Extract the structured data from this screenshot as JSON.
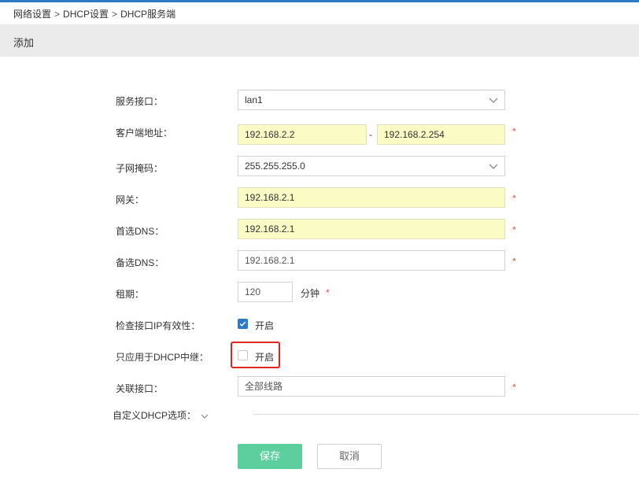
{
  "breadcrumb": {
    "item1": "网络设置",
    "item2": "DHCP设置",
    "item3": "DHCP服务端",
    "separator": ">"
  },
  "section_title": "添加",
  "form": {
    "service_interface": {
      "label": "服务接口：",
      "value": "lan1"
    },
    "client_address": {
      "label": "客户端地址：",
      "start": "192.168.2.2",
      "end": "192.168.2.254",
      "dash": "-"
    },
    "subnet_mask": {
      "label": "子网掩码：",
      "value": "255.255.255.0"
    },
    "gateway": {
      "label": "网关：",
      "value": "192.168.2.1"
    },
    "primary_dns": {
      "label": "首选DNS：",
      "value": "192.168.2.1"
    },
    "secondary_dns": {
      "label": "备选DNS：",
      "value": "192.168.2.1"
    },
    "lease": {
      "label": "租期：",
      "value": "120",
      "unit": "分钟"
    },
    "check_ip_validity": {
      "label": "检查接口IP有效性：",
      "option": "开启",
      "checked": true
    },
    "dhcp_relay_only": {
      "label": "只应用于DHCP中继：",
      "option": "开启",
      "checked": false
    },
    "associated_interface": {
      "label": "关联接口：",
      "value": "全部线路"
    },
    "custom_options": {
      "label": "自定义DHCP选项："
    },
    "required_mark": "*"
  },
  "buttons": {
    "save": "保存",
    "cancel": "取消"
  },
  "colors": {
    "accent": "#2f78c4",
    "save_button": "#5dcf9e",
    "required": "#e84c3d",
    "highlight_box": "#e0261c",
    "autofill": "#fbfbc6"
  }
}
